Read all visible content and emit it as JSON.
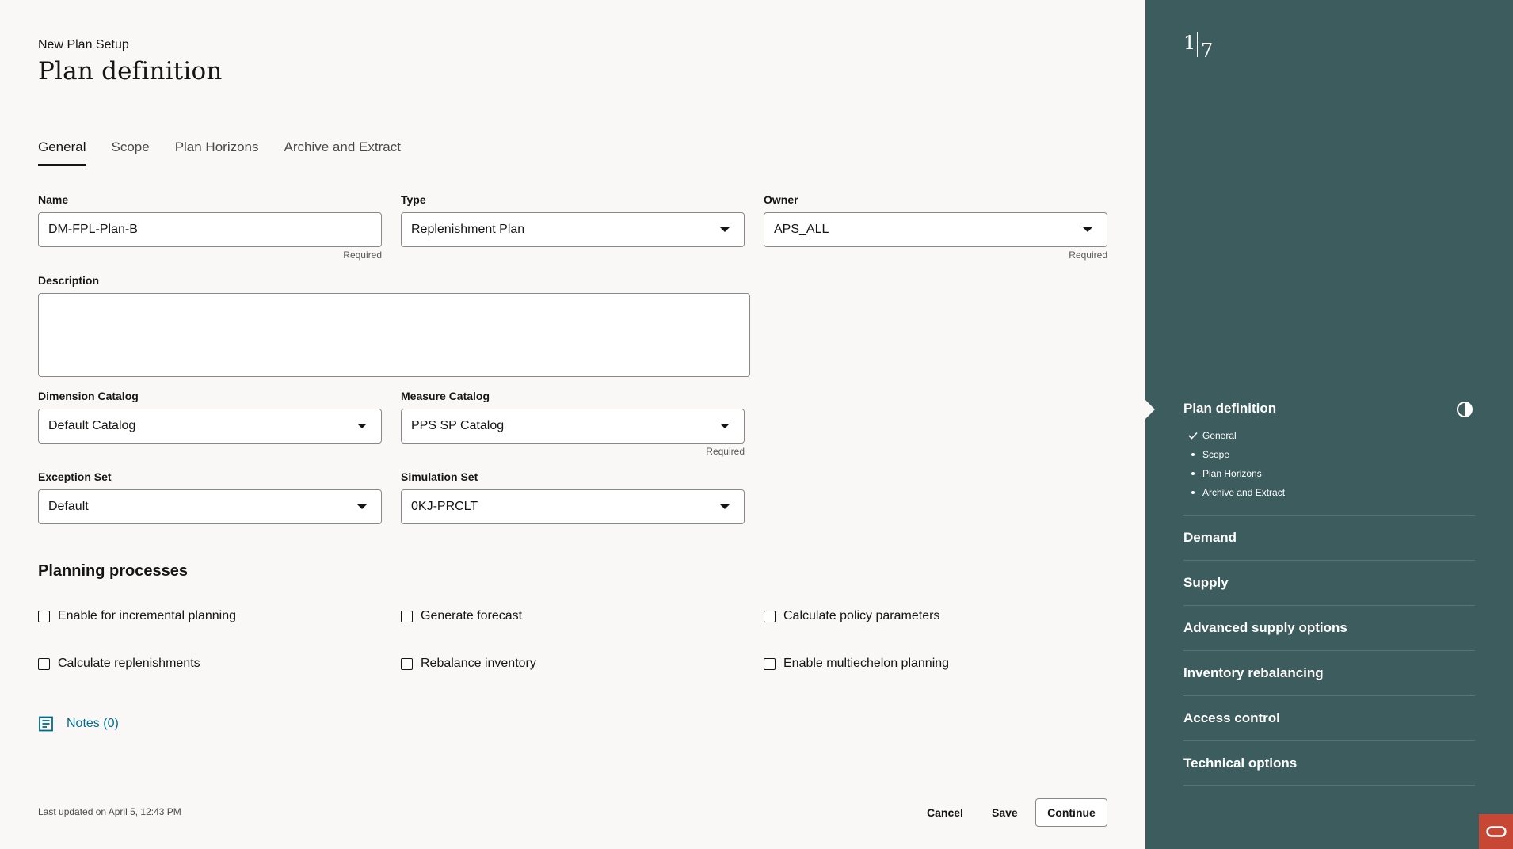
{
  "header": {
    "subtitle": "New Plan Setup",
    "title": "Plan definition"
  },
  "tabs": [
    {
      "label": "General",
      "active": true
    },
    {
      "label": "Scope"
    },
    {
      "label": "Plan Horizons"
    },
    {
      "label": "Archive and Extract"
    }
  ],
  "fields": {
    "name": {
      "label": "Name",
      "value": "DM-FPL-Plan-B",
      "hint": "Required"
    },
    "type": {
      "label": "Type",
      "value": "Replenishment Plan"
    },
    "owner": {
      "label": "Owner",
      "value": "APS_ALL",
      "hint": "Required"
    },
    "description": {
      "label": "Description",
      "value": ""
    },
    "dimension_catalog": {
      "label": "Dimension Catalog",
      "value": "Default Catalog"
    },
    "measure_catalog": {
      "label": "Measure Catalog",
      "value": "PPS SP Catalog",
      "hint": "Required"
    },
    "exception_set": {
      "label": "Exception Set",
      "value": "Default"
    },
    "simulation_set": {
      "label": "Simulation Set",
      "value": "0KJ-PRCLT"
    }
  },
  "planning": {
    "title": "Planning processes",
    "options": [
      {
        "label": "Enable for incremental planning",
        "checked": false
      },
      {
        "label": "Generate forecast",
        "checked": false
      },
      {
        "label": "Calculate policy parameters",
        "checked": false
      },
      {
        "label": "Calculate replenishments",
        "checked": false
      },
      {
        "label": "Rebalance inventory",
        "checked": false
      },
      {
        "label": "Enable multiechelon planning",
        "checked": false
      }
    ]
  },
  "notes": {
    "label": "Notes (0)",
    "icon": "notes-icon"
  },
  "footer": {
    "last_updated": "Last updated on April 5, 12:43 PM",
    "cancel": "Cancel",
    "save": "Save",
    "continue": "Continue"
  },
  "panel": {
    "step_current": "1",
    "step_total": "7",
    "current_step": "Plan definition",
    "substeps": [
      {
        "label": "General",
        "icon": "check-icon"
      },
      {
        "label": "Scope",
        "icon": "bullet"
      },
      {
        "label": "Plan Horizons",
        "icon": "bullet"
      },
      {
        "label": "Archive and Extract",
        "icon": "bullet"
      }
    ],
    "steps": [
      "Demand",
      "Supply",
      "Advanced supply options",
      "Inventory rebalancing",
      "Access control",
      "Technical options"
    ],
    "background": "#3c5c5e",
    "accent_link": "#006b8f",
    "brand": "#c74634"
  }
}
